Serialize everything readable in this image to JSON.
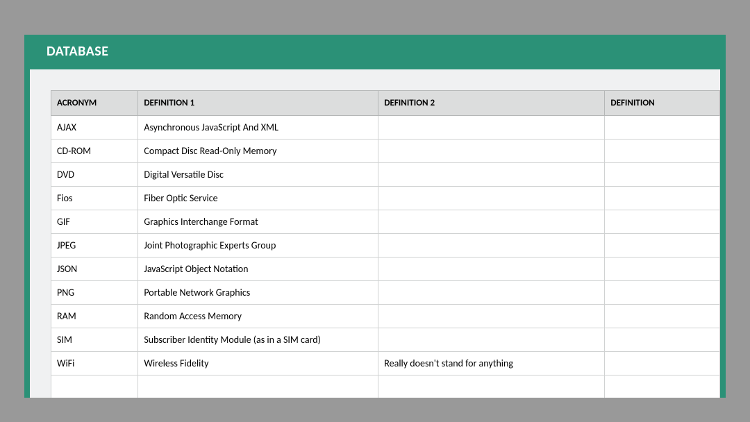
{
  "title": "DATABASE",
  "table": {
    "headers": {
      "acronym": "ACRONYM",
      "def1": "DEFINITION 1",
      "def2": "DEFINITION 2",
      "def3": "DEFINITION"
    },
    "rows": [
      {
        "acronym": "AJAX",
        "def1": "Asynchronous JavaScript And XML",
        "def2": "",
        "def3": ""
      },
      {
        "acronym": "CD-ROM",
        "def1": "Compact Disc Read-Only Memory",
        "def2": "",
        "def3": ""
      },
      {
        "acronym": "DVD",
        "def1": "Digital Versatile Disc",
        "def2": "",
        "def3": ""
      },
      {
        "acronym": "Fios",
        "def1": "Fiber Optic Service",
        "def2": "",
        "def3": ""
      },
      {
        "acronym": "GIF",
        "def1": "Graphics Interchange Format",
        "def2": "",
        "def3": ""
      },
      {
        "acronym": "JPEG",
        "def1": "Joint Photographic Experts Group",
        "def2": "",
        "def3": ""
      },
      {
        "acronym": "JSON",
        "def1": "JavaScript Object Notation",
        "def2": "",
        "def3": ""
      },
      {
        "acronym": "PNG",
        "def1": "Portable Network Graphics",
        "def2": "",
        "def3": ""
      },
      {
        "acronym": "RAM",
        "def1": "Random Access Memory",
        "def2": "",
        "def3": ""
      },
      {
        "acronym": "SIM",
        "def1": "Subscriber Identity Module (as in a SIM card)",
        "def2": "",
        "def3": ""
      },
      {
        "acronym": "WiFi",
        "def1": "Wireless Fidelity",
        "def2": "Really doesn't stand for anything",
        "def3": ""
      },
      {
        "acronym": "",
        "def1": "",
        "def2": "",
        "def3": ""
      }
    ]
  }
}
